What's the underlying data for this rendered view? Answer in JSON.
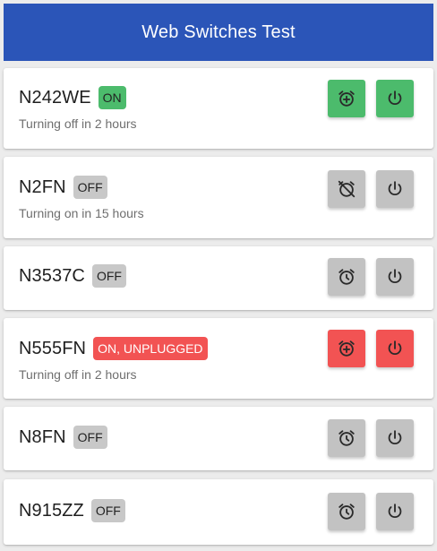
{
  "app": {
    "title": "Web Switches Test"
  },
  "colors": {
    "app_bar": "#2b55b8",
    "on": "#4cbb6c",
    "off": "#c2c2c2",
    "alert": "#f25353"
  },
  "devices": [
    {
      "name": "N242WE",
      "status": "ON",
      "subtitle": "Turning off in 2 hours",
      "timer_icon": "alarm-add-icon",
      "power_icon": "power-icon"
    },
    {
      "name": "N2FN",
      "status": "OFF",
      "subtitle": "Turning on in 15 hours",
      "timer_icon": "alarm-off-icon",
      "power_icon": "power-icon"
    },
    {
      "name": "N3537C",
      "status": "OFF",
      "subtitle": "",
      "timer_icon": "alarm-icon",
      "power_icon": "power-icon"
    },
    {
      "name": "N555FN",
      "status": "ON, UNPLUGGED",
      "subtitle": "Turning off in 2 hours",
      "timer_icon": "alarm-add-icon",
      "power_icon": "power-icon"
    },
    {
      "name": "N8FN",
      "status": "OFF",
      "subtitle": "",
      "timer_icon": "alarm-icon",
      "power_icon": "power-icon"
    },
    {
      "name": "N915ZZ",
      "status": "OFF",
      "subtitle": "",
      "timer_icon": "alarm-icon",
      "power_icon": "power-icon"
    }
  ]
}
